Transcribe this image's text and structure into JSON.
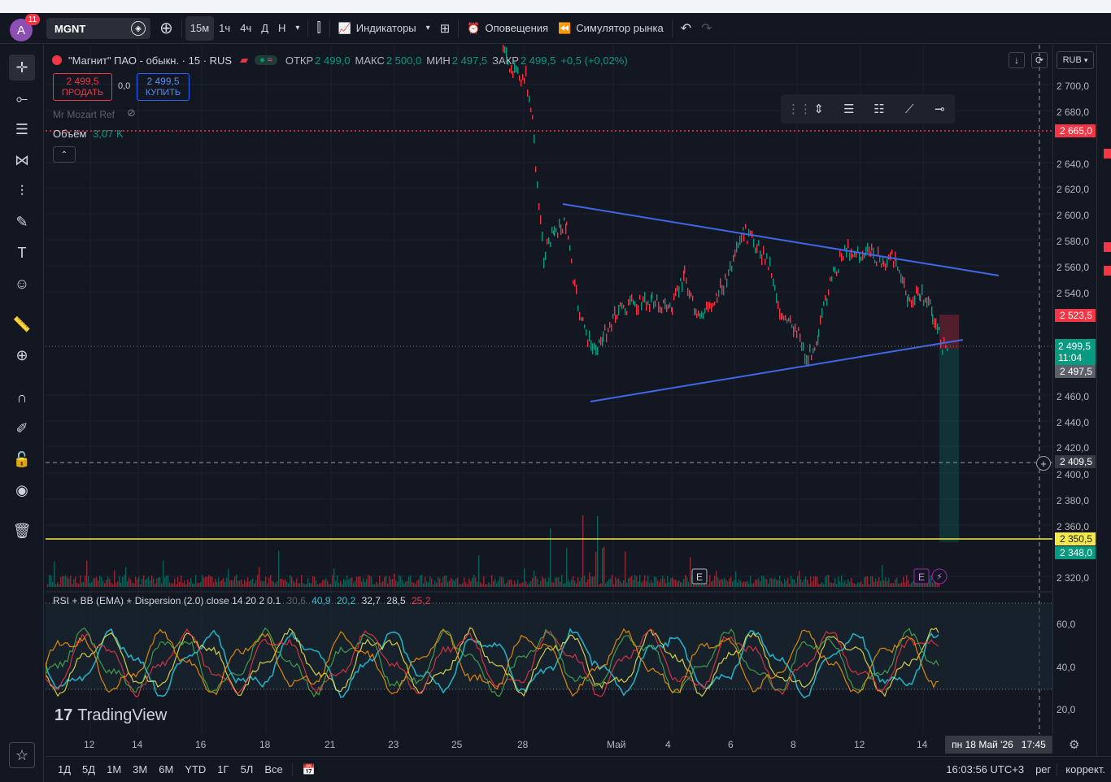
{
  "header": {
    "avatar_letter": "A",
    "notifications": "11",
    "symbol": "MGNT",
    "intervals": [
      "15м",
      "1ч",
      "4ч",
      "Д",
      "Н"
    ],
    "indicators_label": "Индикаторы",
    "alerts_label": "Оповещения",
    "replay_label": "Симулятор рынка"
  },
  "legend": {
    "title": "\"Магнит\" ПАО - обыкн. · 15 · RUS",
    "open_label": "ОТКР",
    "open": "2 499,0",
    "high_label": "МАКС",
    "high": "2 500,0",
    "low_label": "МИН",
    "low": "2 497,5",
    "close_label": "ЗАКР",
    "close": "2 499,5",
    "change": "+0,5 (+0,02%)"
  },
  "trade": {
    "sell_price": "2 499,5",
    "sell_label": "ПРОДАТЬ",
    "spread": "0,0",
    "buy_price": "2 499,5",
    "buy_label": "КУПИТЬ"
  },
  "overlays": {
    "script_name": "Mr Mozart Ref",
    "volume_label": "Объём",
    "volume_value": "3,07 K"
  },
  "indicator": {
    "name": "RSI + BB (EMA) + Dispersion (2.0) close 14 20 2 0.1",
    "v1": "30,6",
    "v2": "40,9",
    "v3": "20,2",
    "v4": "32,7",
    "v5": "28,5",
    "v6": "25,2",
    "scale": [
      "60,0",
      "40,0",
      "20,0"
    ]
  },
  "price_scale": {
    "currency": "RUB",
    "labels": [
      "2 700,0",
      "2 680,0",
      "2 640,0",
      "2 620,0",
      "2 600,0",
      "2 580,0",
      "2 560,0",
      "2 540,0",
      "2 460,0",
      "2 440,0",
      "2 420,0",
      "2 400,0",
      "2 380,0",
      "2 360,0",
      "2 320,0"
    ],
    "tag_red_top": "2 665,0",
    "tag_red_mid": "2 523,5",
    "tag_last": "2 499,5",
    "tag_countdown": "11:04",
    "tag_gray": "2 497,5",
    "tag_cursor": "2 409,5",
    "tag_yellow": "2 350,5",
    "tag_green": "2 348,0"
  },
  "time_scale": {
    "labels": [
      "12",
      "14",
      "16",
      "18",
      "21",
      "23",
      "25",
      "28",
      "Май",
      "4",
      "6",
      "8",
      "12",
      "14"
    ],
    "cursor_time": "пн 18 Май '26",
    "cursor_clock": "17:45"
  },
  "bottom": {
    "ranges": [
      "1Д",
      "5Д",
      "1М",
      "3М",
      "6М",
      "YTD",
      "1Г",
      "5Л",
      "Все"
    ],
    "clock": "16:03:56 UTC+3",
    "session": "рег",
    "adjust": "коррект."
  },
  "brand": "TradingView",
  "colors": {
    "up": "#089981",
    "down": "#f23645",
    "trend": "#3f67e6",
    "accent": "#2962ff",
    "yellow": "#f5e94a"
  }
}
